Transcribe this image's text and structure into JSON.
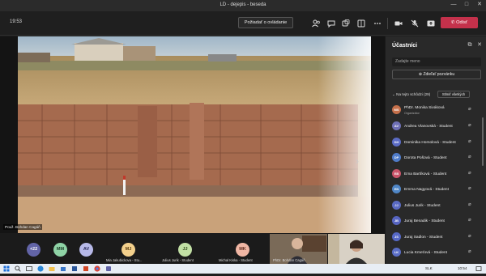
{
  "window": {
    "title": "LD - dejepis - beseda",
    "minimize": "—",
    "maximize": "□",
    "close": "✕"
  },
  "toolbar": {
    "time": "19:53",
    "raise_hand_label": "Požiadať o ovládanie",
    "leave_label": "Odísť",
    "icons": [
      "participants-icon",
      "chat-icon",
      "reactions-icon",
      "rooms-icon",
      "more-icon",
      "camera-icon",
      "mic-off-icon",
      "share-icon"
    ]
  },
  "stage": {
    "presenter_label": "Použ. Bohdan Cagáň",
    "prev_arrow": "‹",
    "next_arrow": "›"
  },
  "gallery": {
    "overflow_count": "+22",
    "tiles": [
      {
        "initials": "MM",
        "color": "#8fd3a6"
      },
      {
        "initials": "AV",
        "color": "#b7b9e8"
      },
      {
        "initials": "MJ",
        "name": "Mia Jakubickova - Stu...",
        "color": "#f3d08c"
      },
      {
        "initials": "JJ",
        "name": "Julius Jurik - Student",
        "color": "#c2e0a5"
      },
      {
        "initials": "MK",
        "name": "Michal Kiska - Student",
        "color": "#f0b6a4"
      }
    ],
    "video_name": "PhDr. Bohdan Cagáň"
  },
  "panel": {
    "title": "Účastníci",
    "search_placeholder": "Zadajte meno",
    "share_invite_label": "Zdieľať pozvánku",
    "section_label": "Na tejto schôdzi (29)",
    "mute_all_label": "Stlmiť všetkých",
    "participants": [
      {
        "initials": "MS",
        "name": "PhDr. Monika Siváková",
        "role": "Organizátor",
        "color": "#c46f4a"
      },
      {
        "initials": "AV",
        "name": "Andrea Vlanovská - Student",
        "role": "",
        "color": "#6e6fb6"
      },
      {
        "initials": "DH",
        "name": "Dominika Homolová - Student",
        "role": "",
        "color": "#5b6bc4"
      },
      {
        "initials": "DP",
        "name": "Dorota Pošová - Student",
        "role": "",
        "color": "#4f7bc8"
      },
      {
        "initials": "EB",
        "name": "Ema Bartíková - Student",
        "role": "",
        "color": "#c9546a"
      },
      {
        "initials": "EN",
        "name": "Emma Nagyová - Student",
        "role": "",
        "color": "#4f86c6"
      },
      {
        "initials": "JJ",
        "name": "Julius Jurik - Student",
        "role": "",
        "color": "#5a6ac2"
      },
      {
        "initials": "JB",
        "name": "Juraj Benadik - Student",
        "role": "",
        "color": "#5664c0"
      },
      {
        "initials": "JS",
        "name": "Juraj Sadlon - Student",
        "role": "",
        "color": "#5567c4"
      },
      {
        "initials": "LK",
        "name": "Lucia Kmeťová - Student",
        "role": "",
        "color": "#5a6dc6"
      }
    ]
  },
  "taskbar": {
    "lang": "SLK",
    "clock": "10:54"
  }
}
